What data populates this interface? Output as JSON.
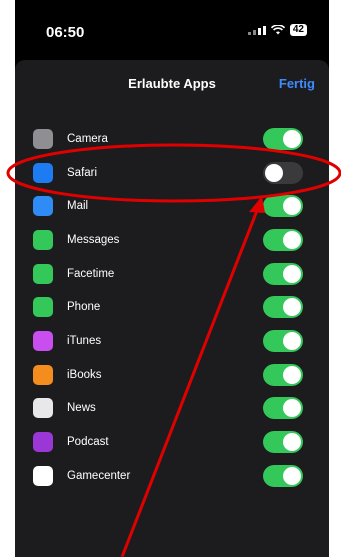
{
  "status": {
    "time": "06:50",
    "battery": "42"
  },
  "header": {
    "title": "Erlaubte Apps",
    "done": "Fertig"
  },
  "apps": [
    {
      "label": "Camera",
      "icon": "camera-icon",
      "color": "#8e8e93",
      "on": true
    },
    {
      "label": "Safari",
      "icon": "safari-icon",
      "color": "#1e7cf2",
      "on": false
    },
    {
      "label": "Mail",
      "icon": "mail-icon",
      "color": "#2f8cf7",
      "on": true
    },
    {
      "label": "Messages",
      "icon": "messages-icon",
      "color": "#34c759",
      "on": true
    },
    {
      "label": "Facetime",
      "icon": "facetime-icon",
      "color": "#34c759",
      "on": true
    },
    {
      "label": "Phone",
      "icon": "phone-icon",
      "color": "#34c759",
      "on": true
    },
    {
      "label": "iTunes",
      "icon": "itunes-icon",
      "color": "#c84ef0",
      "on": true
    },
    {
      "label": "iBooks",
      "icon": "ibooks-icon",
      "color": "#f58d1e",
      "on": true
    },
    {
      "label": "News",
      "icon": "news-icon",
      "color": "#e8e8ea",
      "on": true
    },
    {
      "label": "Podcast",
      "icon": "podcast-icon",
      "color": "#9b37d6",
      "on": true
    },
    {
      "label": "Gamecenter",
      "icon": "gamecenter-icon",
      "color": "#ffffff",
      "on": true
    }
  ],
  "colors": {
    "accent": "#3d8bfd",
    "toggle_on": "#34c759",
    "annotation": "#e00000"
  }
}
